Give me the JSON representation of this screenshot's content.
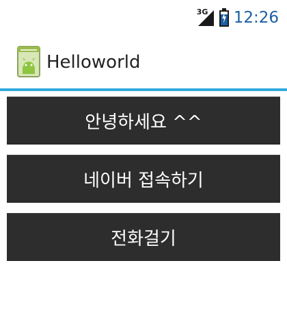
{
  "status_bar": {
    "network_label": "3G",
    "time": "12:26",
    "icons": [
      "signal-icon",
      "battery-icon"
    ]
  },
  "action_bar": {
    "title": "Helloworld",
    "icon": "android-app-icon",
    "divider_color": "#33aadd"
  },
  "buttons": [
    {
      "label": "안녕하세요 ^^"
    },
    {
      "label": "네이버 접속하기"
    },
    {
      "label": "전화걸기"
    }
  ],
  "colors": {
    "button_bg": "#2d2d2d",
    "clock": "#1a5fa3",
    "accent": "#33aadd"
  }
}
